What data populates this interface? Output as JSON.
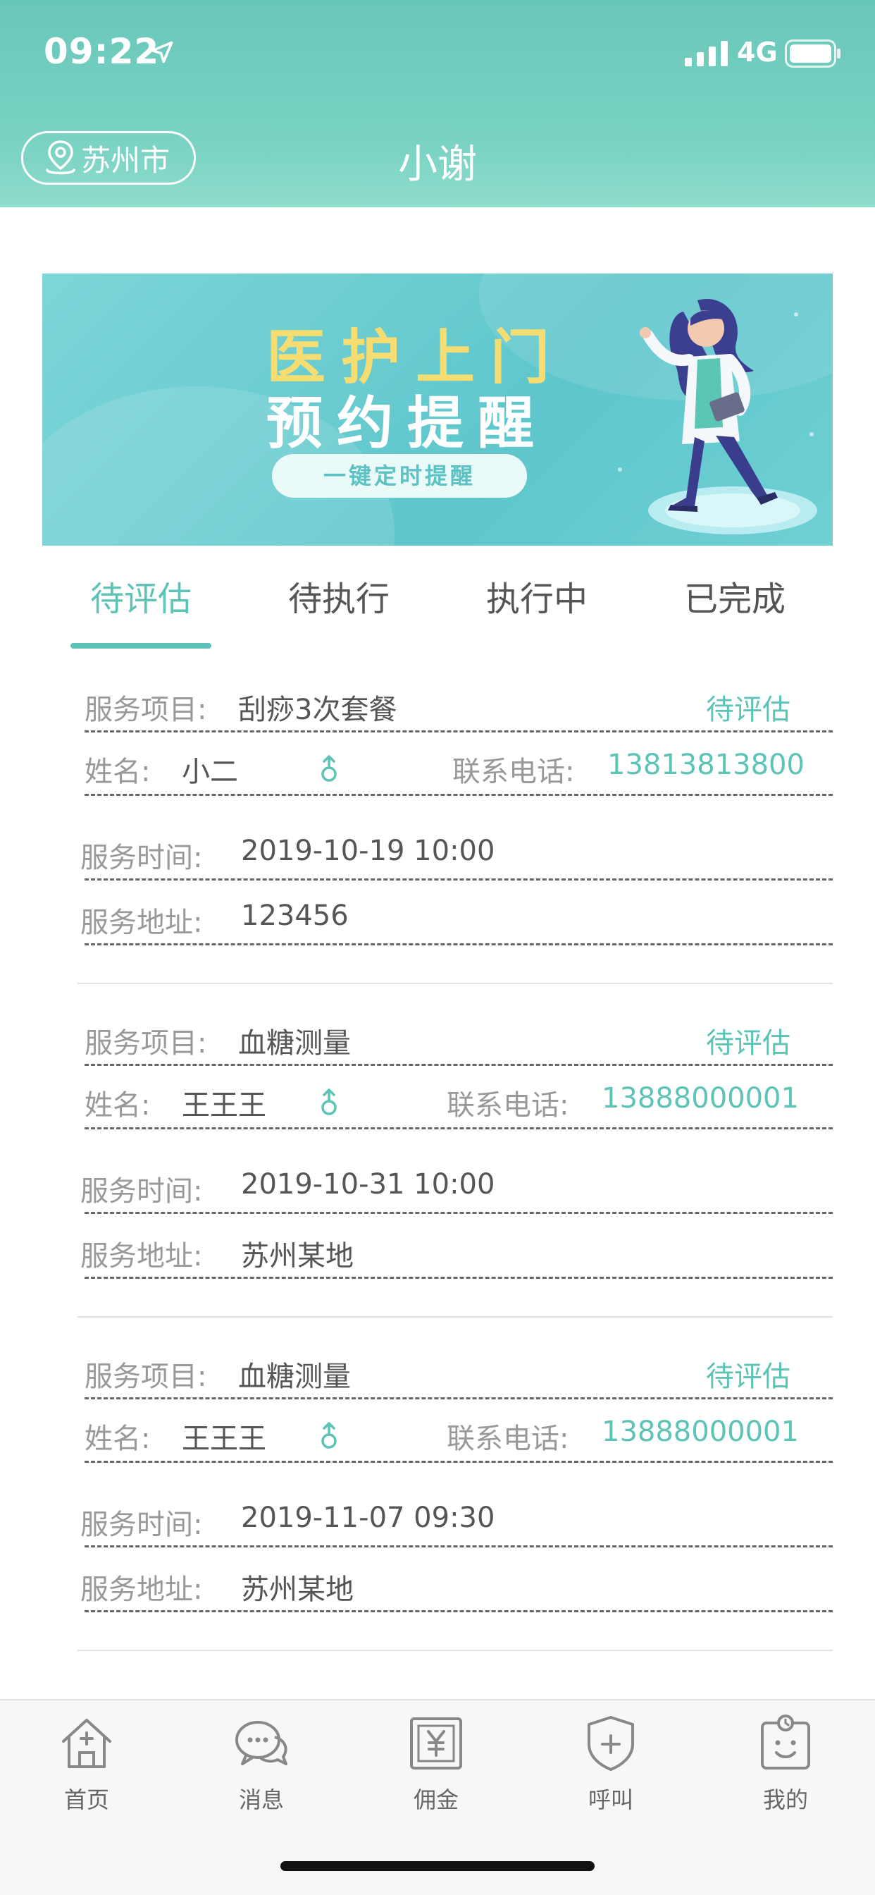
{
  "status_bar": {
    "time": "09:22",
    "network": "4G"
  },
  "header": {
    "city": "苏州市",
    "title": "小谢"
  },
  "banner": {
    "line1": "医护上门",
    "line2": "预约提醒",
    "button": "一键定时提醒"
  },
  "tabs": [
    {
      "label": "待评估",
      "active": true
    },
    {
      "label": "待执行",
      "active": false
    },
    {
      "label": "执行中",
      "active": false
    },
    {
      "label": "已完成",
      "active": false
    }
  ],
  "field_labels": {
    "service_item": "服务项目:",
    "name": "姓名:",
    "phone": "联系电话:",
    "service_time": "服务时间:",
    "service_address": "服务地址:"
  },
  "orders": [
    {
      "service_item": "刮痧3次套餐",
      "status": "待评估",
      "name": "小二",
      "gender": "male",
      "phone": "13813813800",
      "service_time": "2019-10-19 10:00",
      "service_address": "123456"
    },
    {
      "service_item": "血糖测量",
      "status": "待评估",
      "name": "王王王",
      "gender": "male",
      "phone": "13888000001",
      "service_time": "2019-10-31 10:00",
      "service_address": "苏州某地"
    },
    {
      "service_item": "血糖测量",
      "status": "待评估",
      "name": "王王王",
      "gender": "male",
      "phone": "13888000001",
      "service_time": "2019-11-07 09:30",
      "service_address": "苏州某地"
    }
  ],
  "nav": [
    {
      "label": "首页",
      "icon": "home-icon"
    },
    {
      "label": "消息",
      "icon": "message-icon"
    },
    {
      "label": "佣金",
      "icon": "commission-icon"
    },
    {
      "label": "呼叫",
      "icon": "call-shield-icon"
    },
    {
      "label": "我的",
      "icon": "profile-icon"
    }
  ],
  "colors": {
    "accent": "#5cc3b6",
    "header": "#6ec9bb",
    "banner_title": "#f5dd72"
  }
}
